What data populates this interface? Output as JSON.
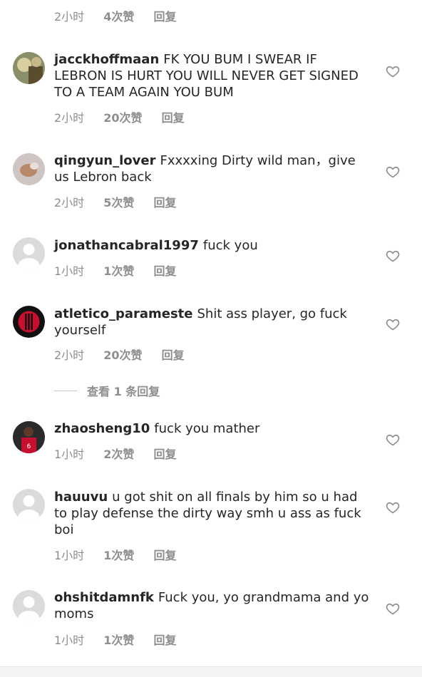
{
  "top_partial": {
    "time": "2小时",
    "likes": "4次赞",
    "reply": "回复"
  },
  "comments": [
    {
      "username": "jacckhoffmaan",
      "text": "FK YOU BUM I SWEAR IF LEBRON IS HURT YOU WILL NEVER GET SIGNED TO A TEAM AGAIN YOU BUM",
      "time": "2小时",
      "likes": "20次赞",
      "reply": "回复"
    },
    {
      "username": "qingyun_lover",
      "text": "Fxxxxing Dirty wild man，give us Lebron back",
      "time": "2小时",
      "likes": "5次赞",
      "reply": "回复"
    },
    {
      "username": "jonathancabral1997",
      "text": "fuck you",
      "time": "1小时",
      "likes": "1次赞",
      "reply": "回复"
    },
    {
      "username": "atletico_parameste",
      "text": "Shit ass player, go fuck yourself",
      "time": "2小时",
      "likes": "20次赞",
      "reply": "回复"
    },
    {
      "username": "zhaosheng10",
      "text": "fuck you mather",
      "time": "1小时",
      "likes": "2次赞",
      "reply": "回复"
    },
    {
      "username": "hauuvu",
      "text": "u got shit on all finals by him so u had to play defense the dirty way smh u ass as fuck boi",
      "time": "1小时",
      "likes": "1次赞",
      "reply": "回复"
    },
    {
      "username": "ohshitdamnfk",
      "text": "Fuck you, yo grandmama and yo moms",
      "time": "1小时",
      "likes": "1次赞",
      "reply": "回复"
    }
  ],
  "view_replies": "查看 1 条回复",
  "icons": {
    "like": "heart-icon",
    "avatar_default": "default-avatar-icon"
  },
  "colors": {
    "meta": "#8e8e8e",
    "text": "#262626"
  }
}
